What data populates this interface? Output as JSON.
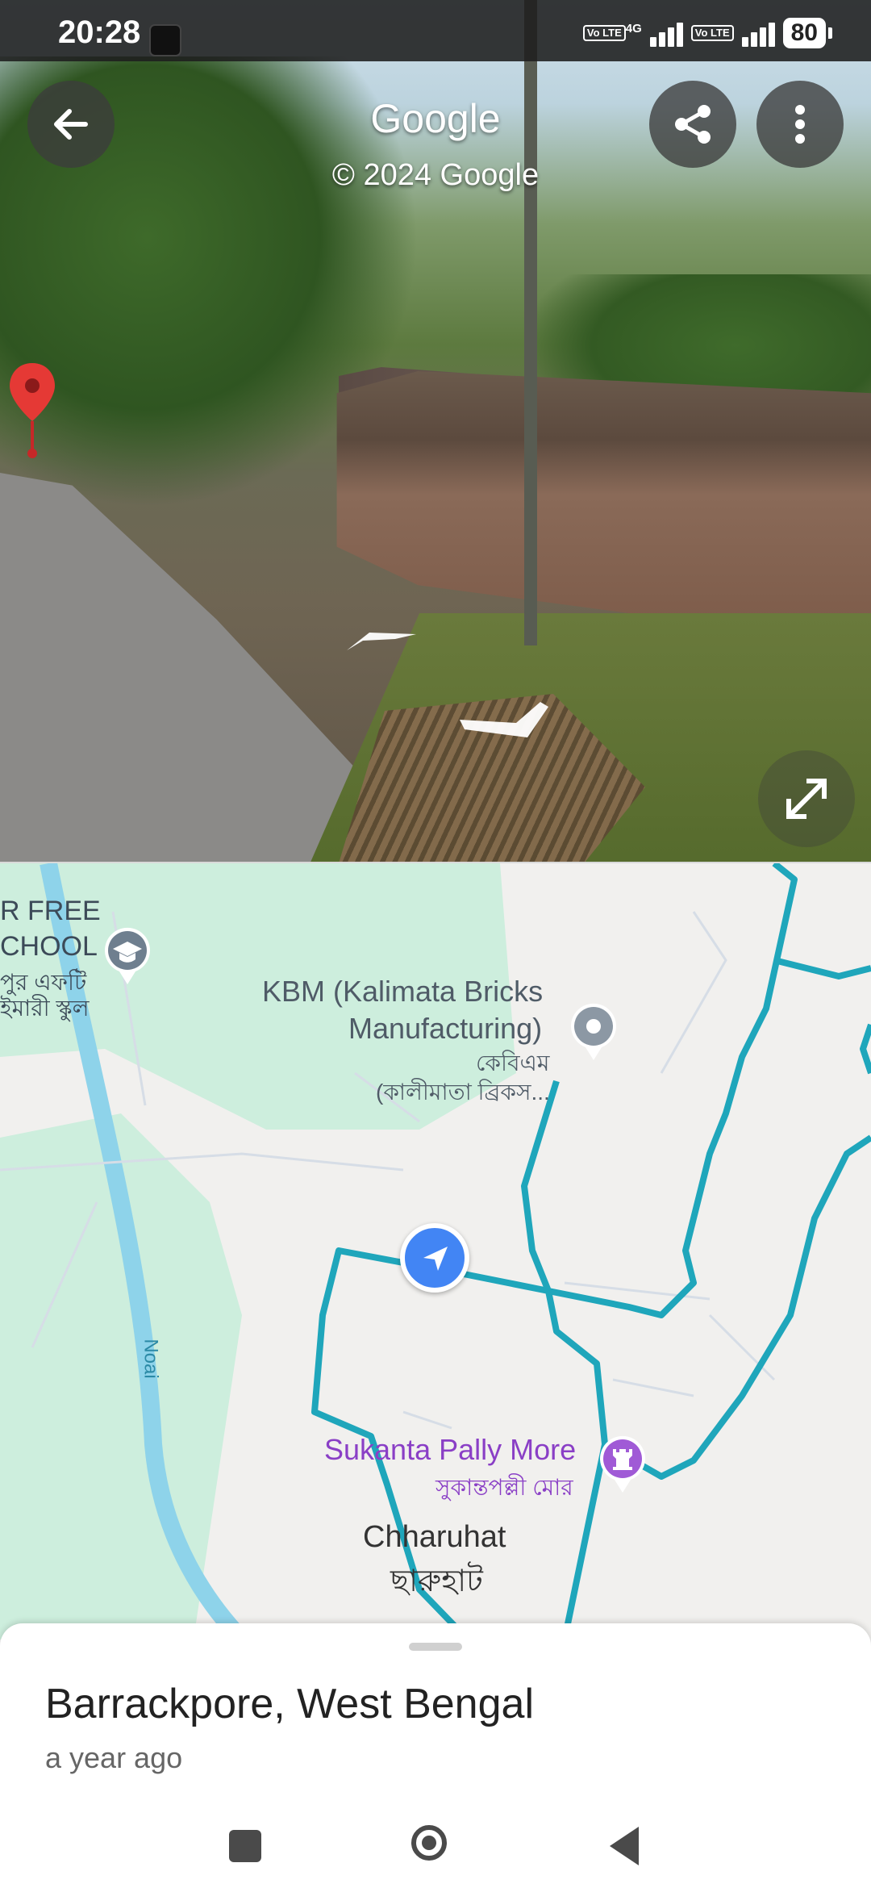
{
  "status_bar": {
    "time": "20:28",
    "volte_1": "Vo LTE",
    "network_1": "4G",
    "volte_2": "Vo LTE",
    "battery": "80"
  },
  "street_view": {
    "title": "Google",
    "copyright": "© 2024 Google",
    "icons": {
      "back": "arrow-left-icon",
      "share": "share-icon",
      "more": "more-vert-icon",
      "expand": "expand-icon",
      "pin": "map-pin-icon"
    }
  },
  "map": {
    "school": {
      "line1": "R FREE",
      "line2": "CHOOL",
      "line3": "পুর এফটি",
      "line4": "ইমারী স্কুল"
    },
    "kbm": {
      "line1": "KBM (Kalimata Bricks",
      "line2": "Manufacturing)",
      "line3": "কেবিএম",
      "line4": "(কালীমাতা ব্রিকস..."
    },
    "river": "Noai",
    "sukanta": {
      "line1": "Sukanta Pally More",
      "line2": "সুকান্তপল্লী মোর"
    },
    "chharuhat": {
      "line1": "Chharuhat",
      "line2": "ছারুহাট"
    },
    "colors": {
      "route": "#1fa6bb",
      "river": "#8ed3ea",
      "green": "#cdeedd",
      "poi_purple": "#a05ad6",
      "location_blue": "#4285f4"
    }
  },
  "sheet": {
    "title": "Barrackpore, West Bengal",
    "subtitle": "a year ago"
  }
}
